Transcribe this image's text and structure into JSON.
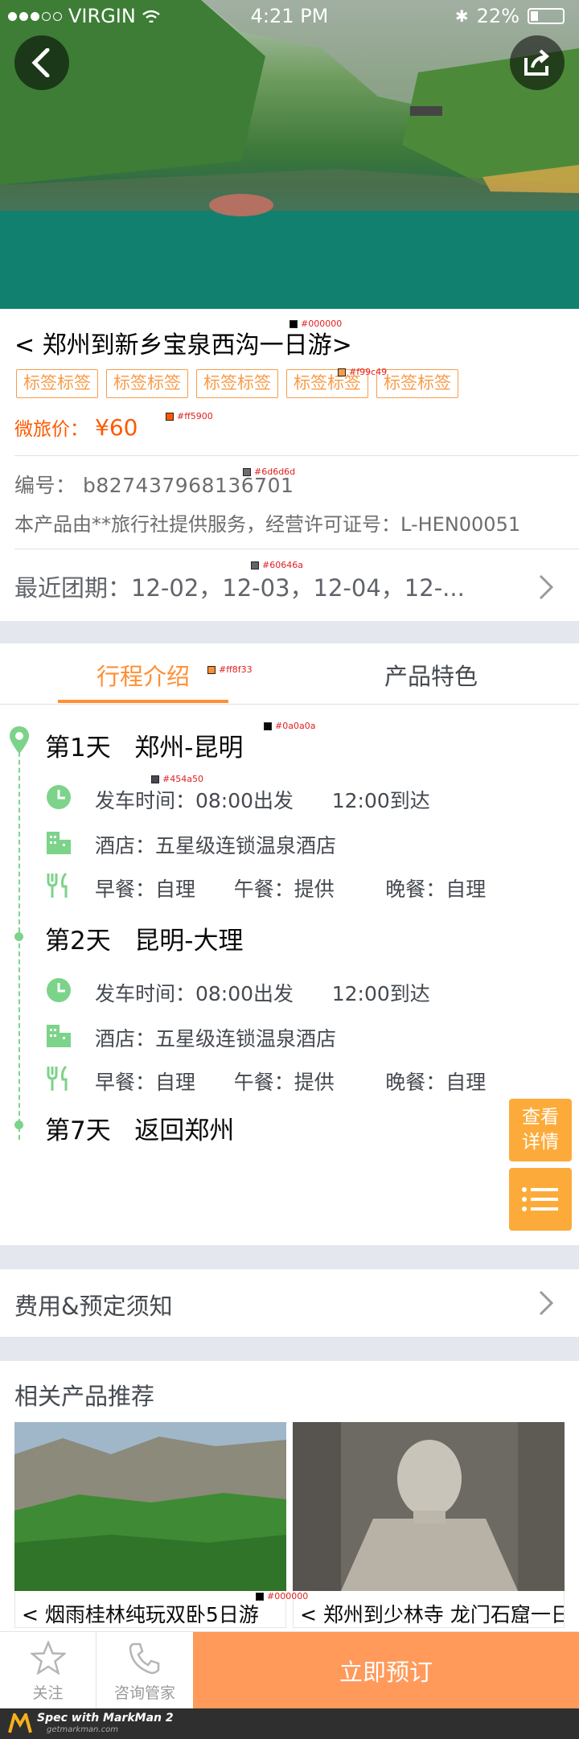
{
  "status_bar": {
    "carrier": "VIRGIN",
    "time": "4:21 PM",
    "battery": "22%"
  },
  "product": {
    "title": "< 郑州到新乡宝泉西沟一日游>",
    "tags": [
      "标签标签",
      "标签标签",
      "标签标签",
      "标签标签",
      "标签标签"
    ],
    "price_label": "微旅价：",
    "price_value": "¥60",
    "code": "编号：  b827437968136701",
    "license": "本产品由**旅行社提供服务，经营许可证号：L-HEN00051",
    "dates": "最近团期：12-02，12-03，12-04，12-..."
  },
  "tabs": [
    "行程介绍",
    "产品特色"
  ],
  "itinerary": [
    {
      "day": "第1天",
      "route": "郑州-昆明",
      "depart": "发车时间：08:00出发",
      "arrive": "12:00到达",
      "hotel": "酒店：五星级连锁温泉酒店",
      "breakfast": "早餐：自理",
      "lunch": "午餐：提供",
      "dinner": "晚餐：自理"
    },
    {
      "day": "第2天",
      "route": "昆明-大理",
      "depart": "发车时间：08:00出发",
      "arrive": "12:00到达",
      "hotel": "酒店：五星级连锁温泉酒店",
      "breakfast": "早餐：自理",
      "lunch": "午餐：提供",
      "dinner": "晚餐：自理"
    },
    {
      "day": "第7天",
      "route": "返回郑州"
    }
  ],
  "float_buttons": {
    "detail_line1": "查看",
    "detail_line2": "详情"
  },
  "fees": "费用&预定须知",
  "recommend": {
    "title": "相关产品推荐",
    "items": [
      "< 烟雨桂林纯玩双卧5日游",
      "< 郑州到少林寺 龙门石窟一日游"
    ]
  },
  "bottom_bar": {
    "follow": "关注",
    "consult": "咨询管家",
    "book": "立即预订"
  },
  "footer": {
    "brand": "Spec with MarkMan 2",
    "url": "getmarkman.com"
  },
  "annotations": [
    "#000000",
    "#f99c49",
    "#ff5900",
    "#6d6d6d",
    "#60646a",
    "#ff8f33",
    "#0a0a0a",
    "#454a50",
    "#000000"
  ],
  "colors": {
    "orange": "#ff8f33",
    "price": "#ff5900",
    "tag": "#f99c49",
    "green": "#7cd38a",
    "float": "#fcab3a",
    "book": "#ff9a5b"
  }
}
